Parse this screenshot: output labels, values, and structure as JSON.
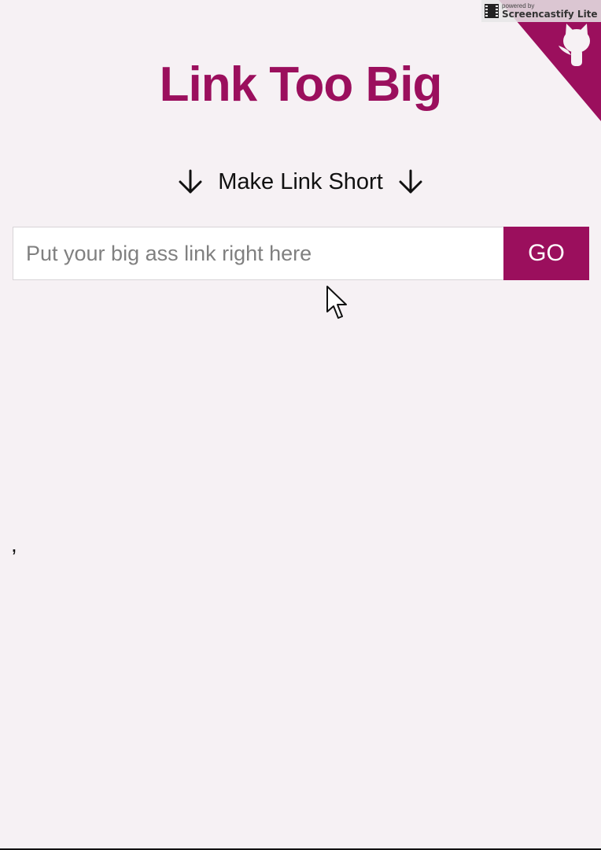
{
  "header": {
    "title": "Link Too Big",
    "subtitle": "Make Link Short"
  },
  "form": {
    "input_value": "",
    "input_placeholder": "Put your big ass link right here",
    "submit_label": "GO"
  },
  "footer_text": ",",
  "watermark": {
    "powered_by": "powered by",
    "brand": "Screencastify Lite"
  },
  "colors": {
    "brand": "#9b0f5d",
    "background": "#f6f1f4"
  },
  "icons": {
    "corner": "github-octocat-icon",
    "subtitle_left": "arrow-down-icon",
    "subtitle_right": "arrow-down-icon",
    "cursor": "mouse-pointer-icon"
  }
}
